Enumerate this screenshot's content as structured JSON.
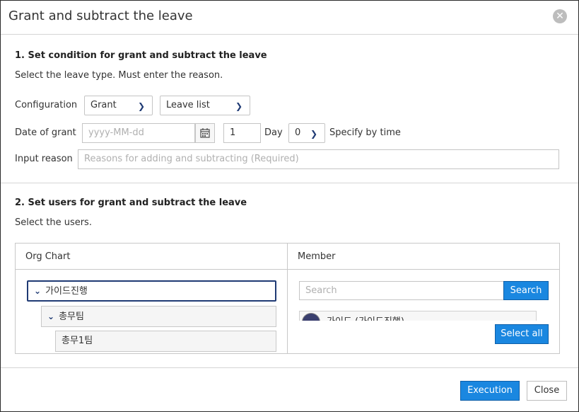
{
  "dialog": {
    "title": "Grant and subtract the leave"
  },
  "section1": {
    "title": "1. Set condition for grant and subtract the leave",
    "desc": "Select the leave type. Must enter the reason."
  },
  "config": {
    "label": "Configuration",
    "type_value": "Grant",
    "list_value": "Leave list"
  },
  "date": {
    "label": "Date of grant",
    "placeholder": "yyyy-MM-dd",
    "day_value": "1",
    "day_unit": "Day",
    "time_value": "0",
    "time_label": "Specify by time"
  },
  "reason": {
    "label": "Input reason",
    "placeholder": "Reasons for adding and subtracting (Required)"
  },
  "section2": {
    "title": "2. Set users for grant and subtract the leave",
    "desc": "Select the users."
  },
  "org": {
    "header": "Org Chart",
    "nodes": [
      {
        "label": "가이드진행"
      },
      {
        "label": "총무팀"
      },
      {
        "label": "총무1팀"
      }
    ]
  },
  "member": {
    "header": "Member",
    "search_placeholder": "Search",
    "search_button": "Search",
    "row_text": "가이드 (가이드진행)",
    "select_all": "Select all"
  },
  "footer": {
    "execute": "Execution",
    "close": "Close"
  }
}
